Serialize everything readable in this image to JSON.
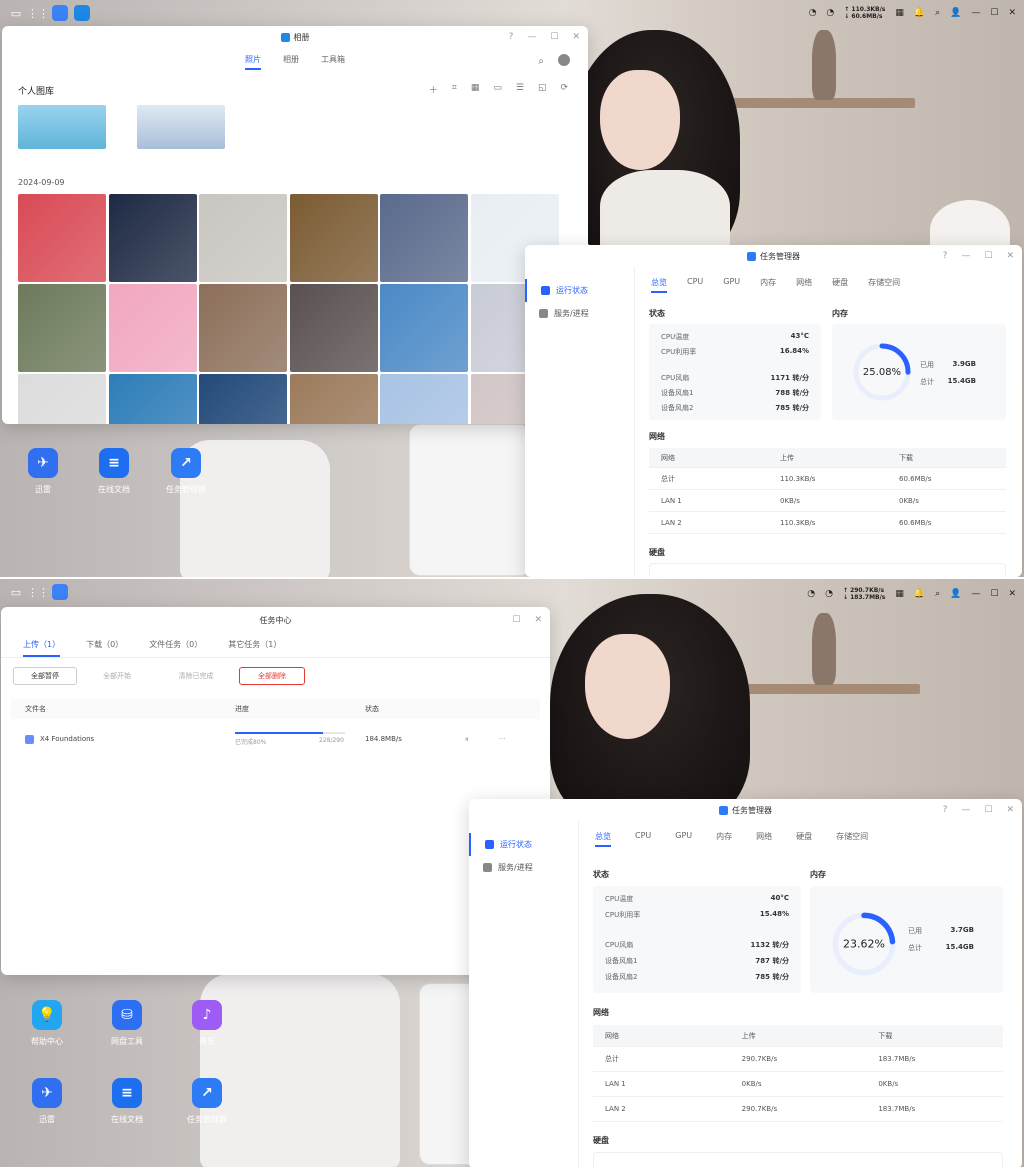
{
  "top": {
    "taskbar": {
      "net_up": "↑ 110.3KB/s",
      "net_down": "↓ 60.6MB/s"
    },
    "photos": {
      "title": "相册",
      "tabs": [
        "照片",
        "相册",
        "工具箱"
      ],
      "library_label": "个人图库",
      "date": "2024-09-09"
    },
    "desktop_icons": [
      "迅雷",
      "在线文档",
      "任务管理器"
    ],
    "taskmgr": {
      "title": "任务管理器",
      "side": [
        "运行状态",
        "服务/进程"
      ],
      "tabs": [
        "总览",
        "CPU",
        "GPU",
        "内存",
        "网络",
        "硬盘",
        "存储空间"
      ],
      "status_label": "状态",
      "memory_label": "内存",
      "cpu_temp_label": "CPU温度",
      "cpu_temp": "43°C",
      "cpu_usage_label": "CPU利用率",
      "cpu_usage": "16.84%",
      "cpu_fan_label": "CPU风扇",
      "cpu_fan": "1171 转/分",
      "fan1_label": "设备风扇1",
      "fan1": "788 转/分",
      "fan2_label": "设备风扇2",
      "fan2": "785 转/分",
      "mem_percent": "25.08%",
      "mem_percent_value": 25.08,
      "used_label": "已用",
      "used": "3.9GB",
      "total_label": "总计",
      "total": "15.4GB",
      "network_label": "网络",
      "net_headers": [
        "网络",
        "上传",
        "下载"
      ],
      "net_rows": [
        [
          "总计",
          "110.3KB/s",
          "60.6MB/s"
        ],
        [
          "LAN 1",
          "0KB/s",
          "0KB/s"
        ],
        [
          "LAN 2",
          "110.3KB/s",
          "60.6MB/s"
        ]
      ],
      "disk_label": "硬盘"
    }
  },
  "bot": {
    "taskbar": {
      "net_up": "↑ 290.7KB/s",
      "net_down": "↓ 183.7MB/s"
    },
    "taskcenter": {
      "title": "任务中心",
      "tabs": [
        "上传（1）",
        "下载（0）",
        "文件任务（0）",
        "其它任务（1）"
      ],
      "buttons": [
        "全部暂停",
        "全部开始",
        "清除已完成",
        "全部删除"
      ],
      "headers": [
        "文件名",
        "进度",
        "状态"
      ],
      "file": "X4 Foundations",
      "progress_text": "已完成80%",
      "progress_count": "228/290",
      "progress_value": 80,
      "speed": "184.8MB/s"
    },
    "desktop_icons": [
      "帮助中心",
      "网盘工具",
      "音乐",
      "迅雷",
      "在线文档",
      "任务管理器"
    ],
    "taskmgr": {
      "title": "任务管理器",
      "side": [
        "运行状态",
        "服务/进程"
      ],
      "tabs": [
        "总览",
        "CPU",
        "GPU",
        "内存",
        "网络",
        "硬盘",
        "存储空间"
      ],
      "status_label": "状态",
      "memory_label": "内存",
      "cpu_temp_label": "CPU温度",
      "cpu_temp": "40°C",
      "cpu_usage_label": "CPU利用率",
      "cpu_usage": "15.48%",
      "cpu_fan_label": "CPU风扇",
      "cpu_fan": "1132 转/分",
      "fan1_label": "设备风扇1",
      "fan1": "787 转/分",
      "fan2_label": "设备风扇2",
      "fan2": "785 转/分",
      "mem_percent": "23.62%",
      "mem_percent_value": 23.62,
      "used_label": "已用",
      "used": "3.7GB",
      "total_label": "总计",
      "total": "15.4GB",
      "network_label": "网络",
      "net_headers": [
        "网络",
        "上传",
        "下载"
      ],
      "net_rows": [
        [
          "总计",
          "290.7KB/s",
          "183.7MB/s"
        ],
        [
          "LAN 1",
          "0KB/s",
          "0KB/s"
        ],
        [
          "LAN 2",
          "290.7KB/s",
          "183.7MB/s"
        ]
      ],
      "disk_label": "硬盘"
    }
  },
  "colors": {
    "accent": "#2962ff",
    "danger": "#e53935"
  }
}
